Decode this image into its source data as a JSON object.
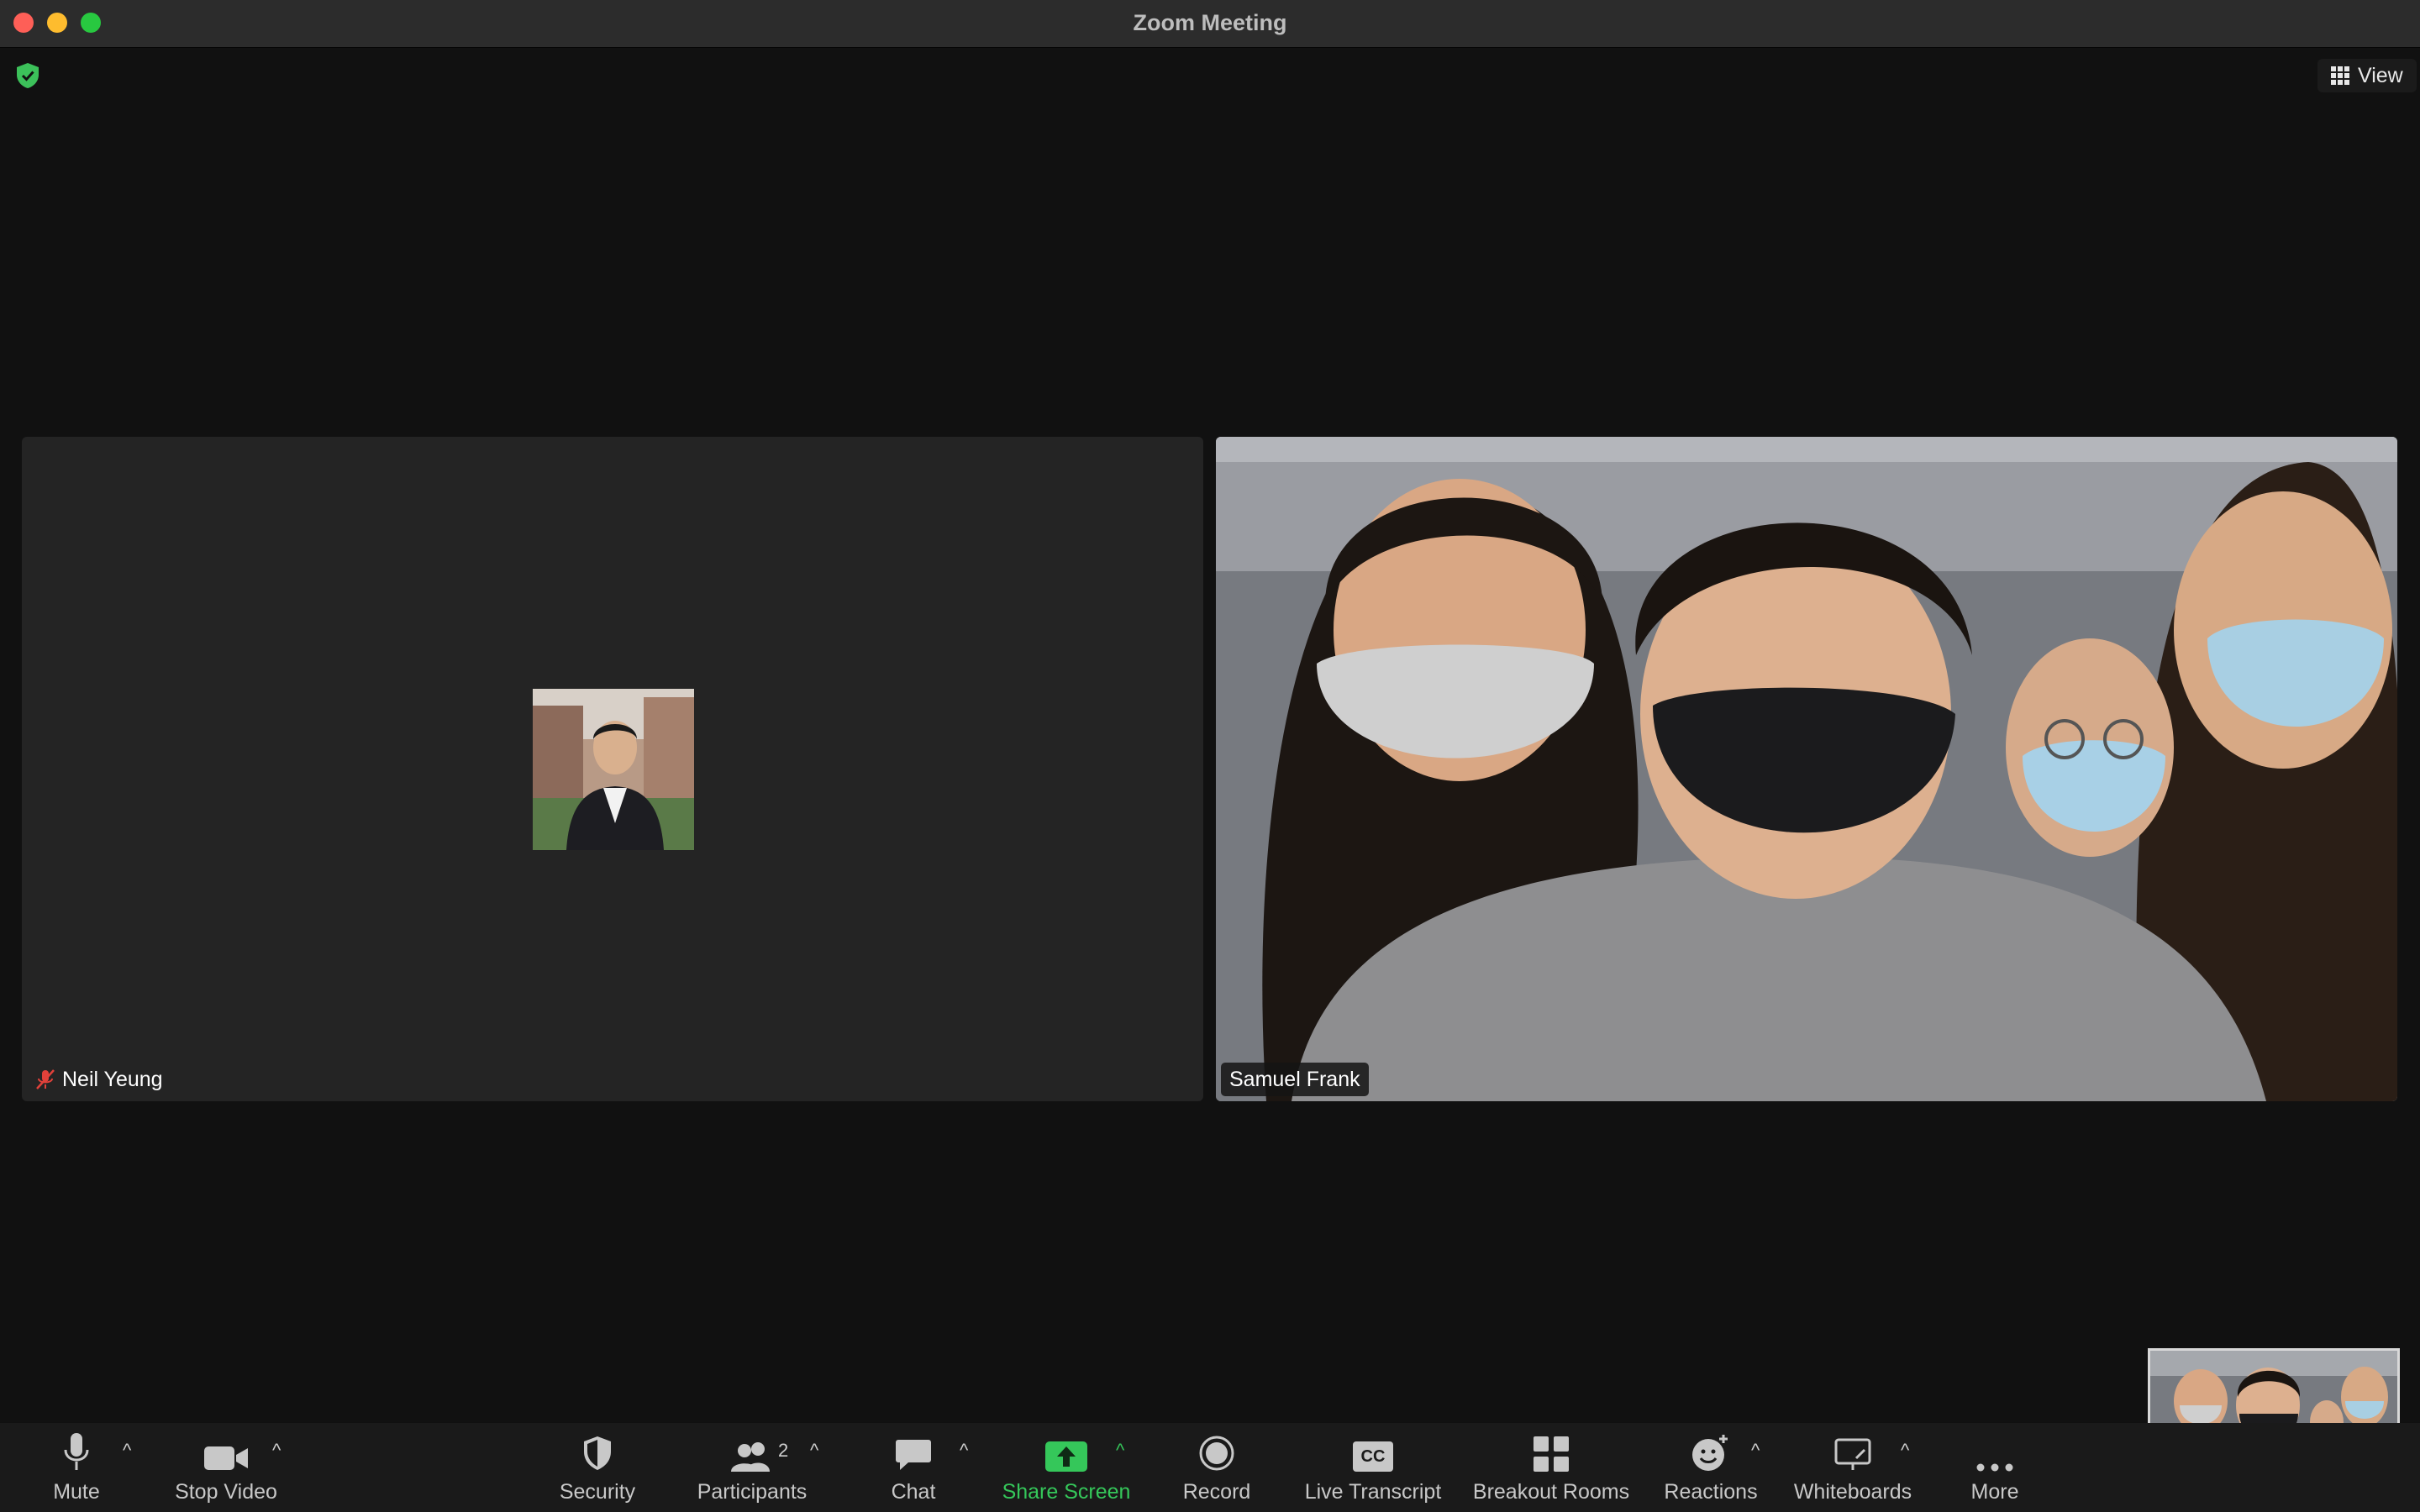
{
  "window": {
    "title": "Zoom Meeting"
  },
  "view_button": {
    "label": "View"
  },
  "participants": [
    {
      "name": "Neil Yeung",
      "muted": true,
      "video": false
    },
    {
      "name": "Samuel Frank",
      "muted": false,
      "video": true
    }
  ],
  "toolbar": {
    "mute": "Mute",
    "stop_video": "Stop Video",
    "security": "Security",
    "participants": "Participants",
    "participants_count": "2",
    "chat": "Chat",
    "share_screen": "Share Screen",
    "record": "Record",
    "live_transcript": "Live Transcript",
    "cc_badge": "CC",
    "breakout_rooms": "Breakout Rooms",
    "reactions": "Reactions",
    "whiteboards": "Whiteboards",
    "more": "More"
  },
  "colors": {
    "accent_green": "#35c75a",
    "security_green": "#3cc15a",
    "muted_red": "#e0413a"
  }
}
